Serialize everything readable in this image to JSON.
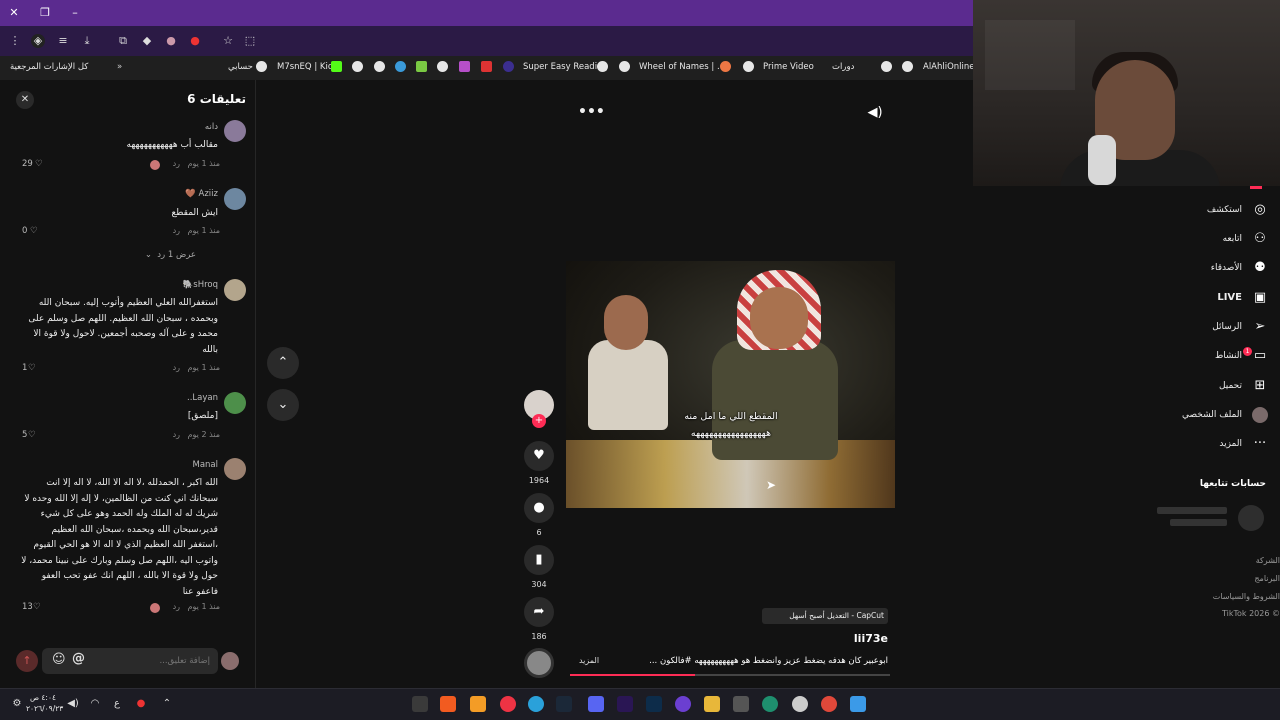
{
  "browser": {
    "bookmarks": [
      "كل الإشارات المرجعية",
      "حسابي",
      "M7snEQ | Kick",
      "Super Easy Reading",
      "Wheel of Names | ...م",
      "Prime Video",
      "دورات",
      "AlAhliOnline"
    ]
  },
  "comments_panel": {
    "title": "تعليقات 6",
    "items": [
      {
        "name": "دانه",
        "text": "مقالب أب هههههههههههه",
        "time": "منذ 1 يوم",
        "reply": "رد",
        "likes": "29"
      },
      {
        "name": "Aziiz 🤎",
        "text": "ايش المقطع",
        "time": "منذ 1 يوم",
        "reply": "رد",
        "likes": "0",
        "replies_toggle": "عرض 1 رد"
      },
      {
        "name": "sHroq🐘",
        "text": "استغفرالله العلي العظيم وأتوب إليه. سبحان الله وبحمده ، سبحان الله العظيم. اللهم صل وسلم على محمد و على آله وصحبه أجمعين. لاحول ولا قوة الا بالله",
        "time": "منذ 1 يوم",
        "reply": "رد",
        "likes": "1"
      },
      {
        "name": "Layan..",
        "text": "[ملصق]",
        "time": "منذ 2 يوم",
        "reply": "رد",
        "likes": "5"
      },
      {
        "name": "Manal",
        "text": "الله اكبر ، الحمدلله ،لا اله الا الله، لا اله إلا انت سبحانك اني كنت من الظالمين، لا إله إلا الله وحده لا شريك له له الملك وله الحمد وهو على كل شيء قدير،سبحان الله وبحمده ،سبحان الله العظيم ،استغفر الله العظيم الذي لا اله الا هو الحي القيوم واتوب اليه ،اللهم صل وسلم وبارك على نبينا محمد، لا حول ولا قوة الا بالله ، اللهم انك عفو تحب العفو فاعفو عنا",
        "time": "منذ 1 يوم",
        "reply": "رد",
        "likes": "13"
      }
    ],
    "input_placeholder": "إضافة تعليق..."
  },
  "player": {
    "caption_line1": "المقطع اللي ما امل منه",
    "caption_line2": "هههههههههههههههههه",
    "likes": "1964",
    "comments": "6",
    "saves": "304",
    "shares": "186",
    "capcut_tag": "CapCut - التعديل أصبح أسهل",
    "author": "lii73e",
    "description": "ابوعبير كان هدفه يضغط عزيز وانضغط هو ههههههههههه #فالكون ...",
    "more_label": "المزيد",
    "progress": 0.39
  },
  "sidebar": {
    "nav": [
      {
        "label": "استكشف",
        "icon": "compass-icon"
      },
      {
        "label": "اتابعه",
        "icon": "following-icon"
      },
      {
        "label": "الأصدقاء",
        "icon": "friends-icon"
      },
      {
        "label": "LIVE",
        "icon": "live-icon"
      },
      {
        "label": "الرسائل",
        "icon": "messages-icon"
      },
      {
        "label": "النشاط",
        "icon": "activity-icon"
      },
      {
        "label": "تحميل",
        "icon": "upload-icon"
      },
      {
        "label": "الملف الشخصي",
        "icon": "profile-icon"
      },
      {
        "label": "المزيد",
        "icon": "more-icon"
      }
    ],
    "activity_badge": "1",
    "following_title": "حسابات تتابعها",
    "footer": [
      "الشركة",
      "البرنامج",
      "الشروط والسياسات",
      "© 2026 TikTok"
    ]
  },
  "taskbar": {
    "time": "٤:٠٤ ص",
    "date": "٢٠٢٦/٠٩/٢٣",
    "lang": "ع"
  },
  "colors": {
    "accent": "#fe2c55",
    "titlebar": "#5b2b8f"
  }
}
